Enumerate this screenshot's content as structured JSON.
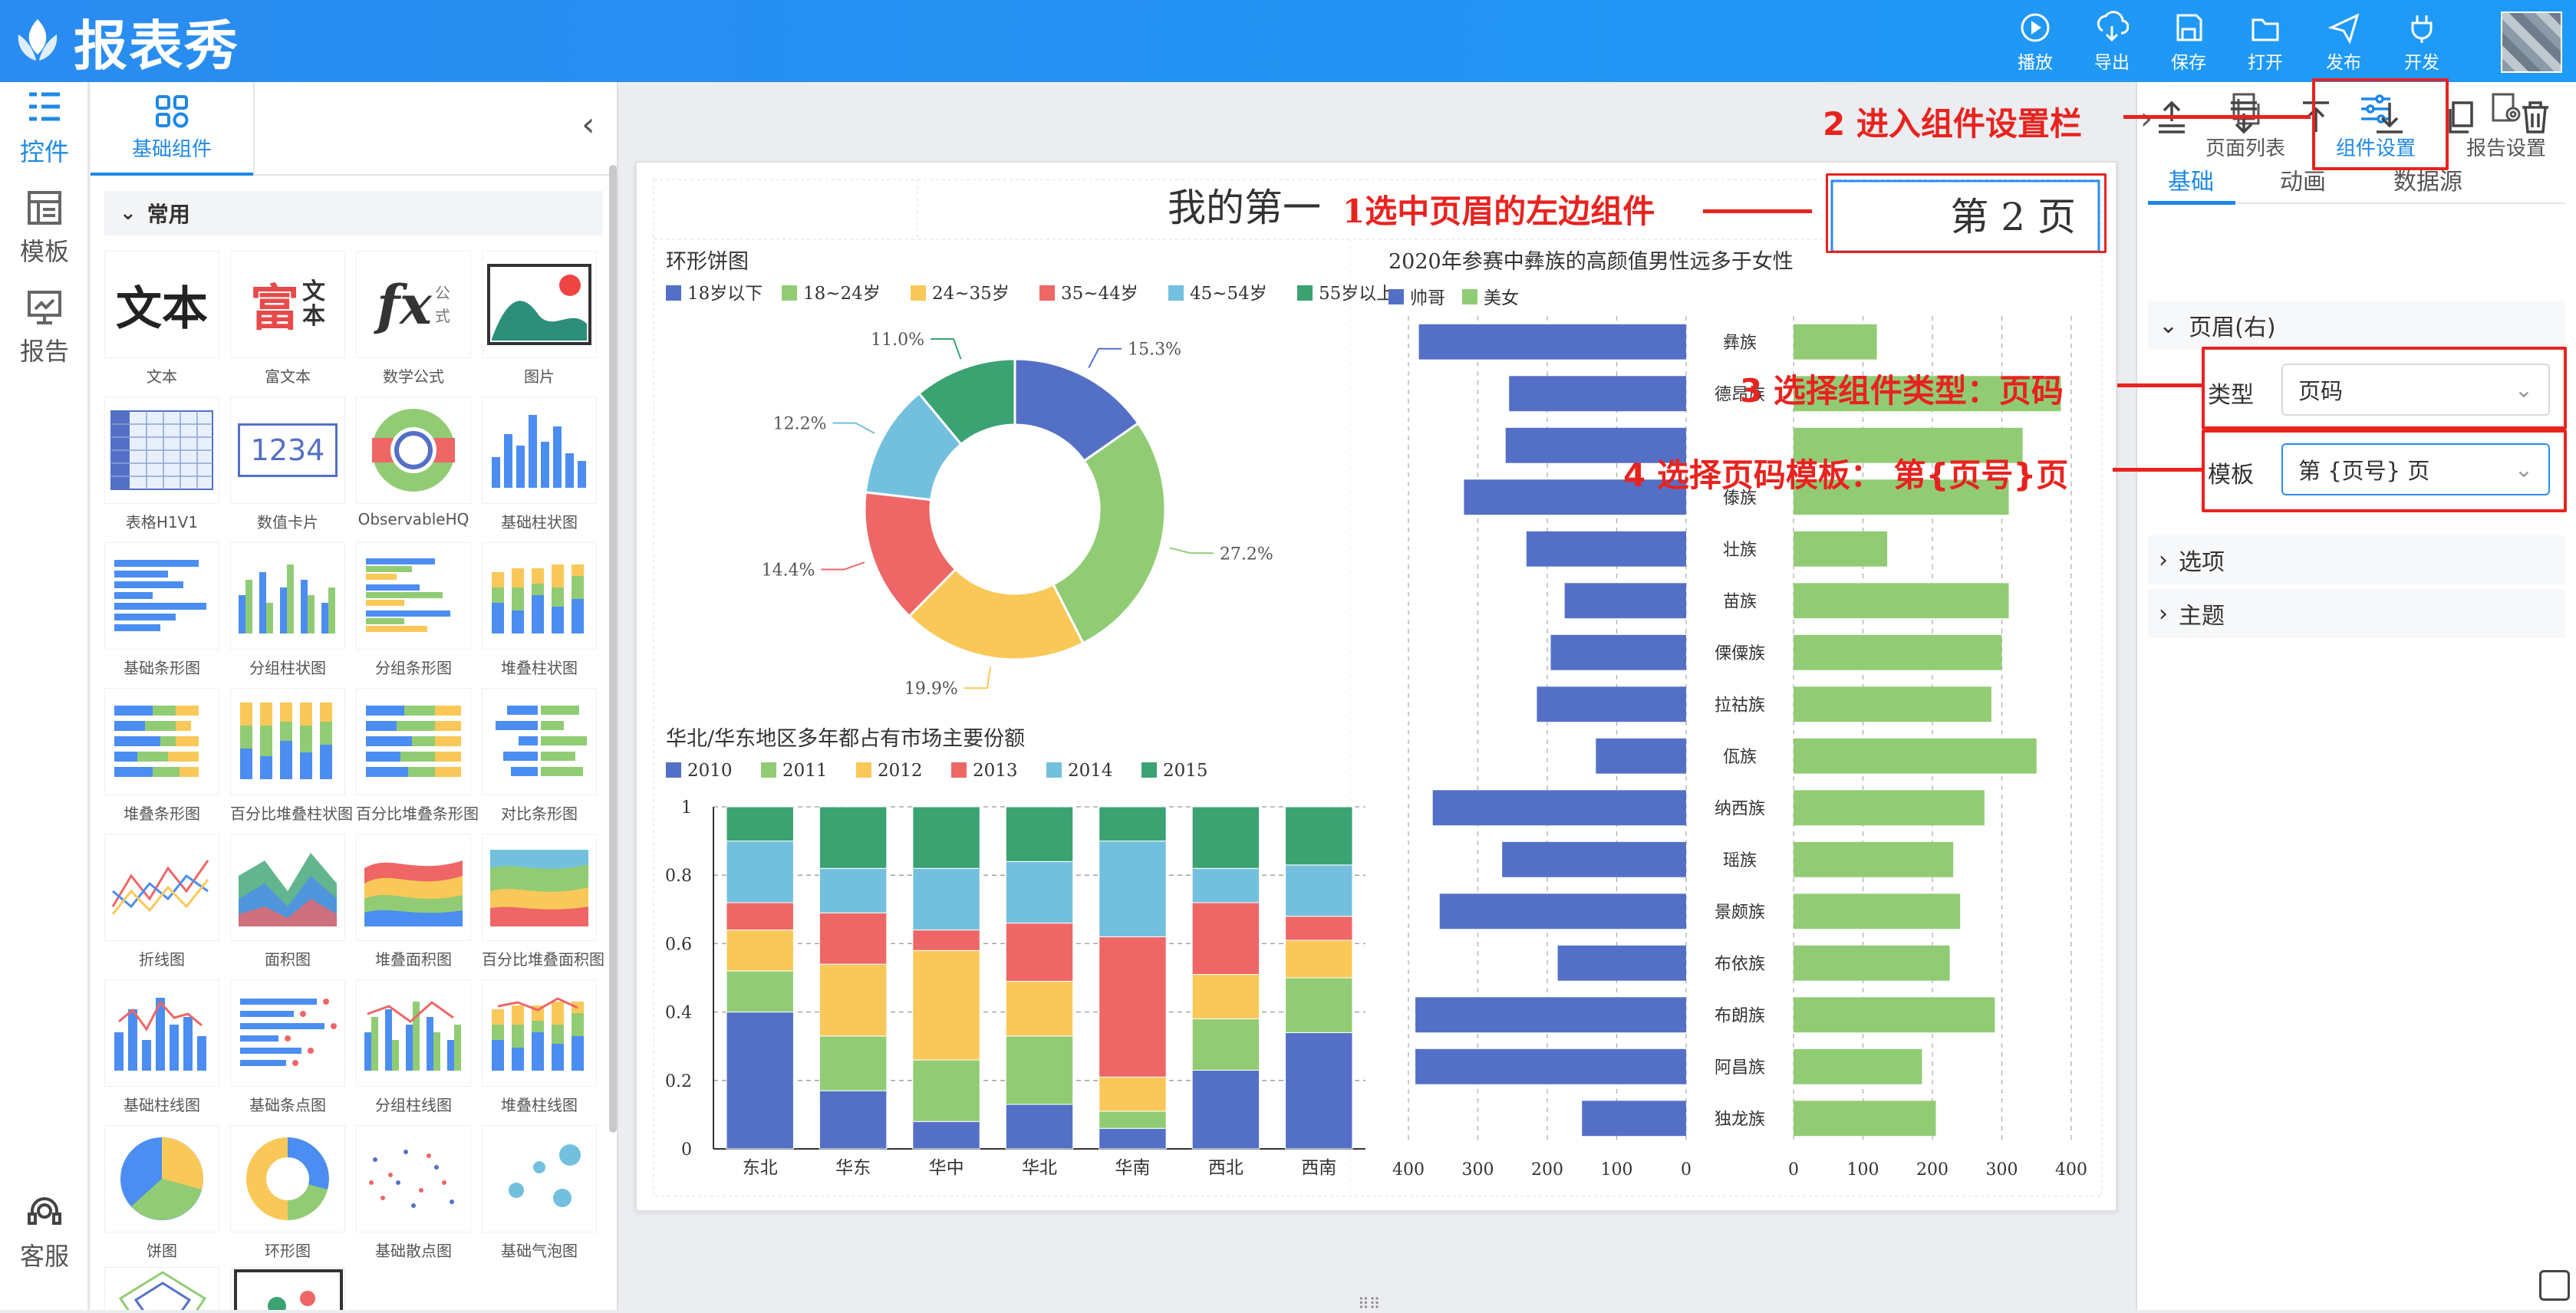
{
  "app": {
    "title": "报表秀"
  },
  "toolbar": {
    "items": [
      {
        "label": "播放",
        "icon": "play-icon"
      },
      {
        "label": "导出",
        "icon": "export-icon"
      },
      {
        "label": "保存",
        "icon": "save-icon"
      },
      {
        "label": "打开",
        "icon": "folder-icon"
      },
      {
        "label": "发布",
        "icon": "send-icon"
      },
      {
        "label": "开发",
        "icon": "plug-icon"
      }
    ]
  },
  "leftnav": {
    "items": [
      {
        "label": "控件",
        "icon": "widgets-icon"
      },
      {
        "label": "模板",
        "icon": "template-icon"
      },
      {
        "label": "报告",
        "icon": "report-icon"
      }
    ],
    "support": "客服"
  },
  "components": {
    "tab": "基础组件",
    "category": "常用",
    "items": [
      {
        "label": "文本",
        "glyph": "文本"
      },
      {
        "label": "富文本"
      },
      {
        "label": "数学公式"
      },
      {
        "label": "图片"
      },
      {
        "label": "表格H1V1"
      },
      {
        "label": "数值卡片",
        "glyph": "1234"
      },
      {
        "label": "ObservableHQ"
      },
      {
        "label": "基础柱状图"
      },
      {
        "label": "基础条形图"
      },
      {
        "label": "分组柱状图"
      },
      {
        "label": "分组条形图"
      },
      {
        "label": "堆叠柱状图"
      },
      {
        "label": "堆叠条形图"
      },
      {
        "label": "百分比堆叠柱状图"
      },
      {
        "label": "百分比堆叠条形图"
      },
      {
        "label": "对比条形图"
      },
      {
        "label": "折线图"
      },
      {
        "label": "面积图"
      },
      {
        "label": "堆叠面积图"
      },
      {
        "label": "百分比堆叠面积图"
      },
      {
        "label": "基础柱线图"
      },
      {
        "label": "基础条点图"
      },
      {
        "label": "分组柱线图"
      },
      {
        "label": "堆叠柱线图"
      },
      {
        "label": "饼图"
      },
      {
        "label": "环形图"
      },
      {
        "label": "基础散点图"
      },
      {
        "label": "基础气泡图"
      }
    ],
    "rich_glyph_1": "富",
    "rich_glyph_2": "文",
    "rich_glyph_3": "本",
    "math_glyph": "fx",
    "math_small_1": "公",
    "math_small_2": "式"
  },
  "report": {
    "header_left": "我的第一",
    "header_right": "第 2 页"
  },
  "chart_data": [
    {
      "type": "pie",
      "title": "环形饼图",
      "legend": [
        "18岁以下",
        "18~24岁",
        "24~35岁",
        "35~44岁",
        "45~54岁",
        "55岁以上"
      ],
      "colors": [
        "#5470c6",
        "#91cc75",
        "#fac858",
        "#ee6666",
        "#73c0de",
        "#3ba272"
      ],
      "values": [
        15.3,
        27.2,
        19.9,
        14.4,
        12.2,
        11.0
      ],
      "labels": [
        "15.3%",
        "27.2%",
        "19.9%",
        "14.4%",
        "12.2%",
        "11.0%"
      ]
    },
    {
      "type": "bar",
      "title": "华北/华东地区多年都占有市场主要份额",
      "categories": [
        "东北",
        "华东",
        "华中",
        "华北",
        "华南",
        "西北",
        "西南"
      ],
      "series": [
        {
          "name": "2010",
          "values": [
            0.4,
            0.17,
            0.08,
            0.13,
            0.06,
            0.23,
            0.34
          ]
        },
        {
          "name": "2011",
          "values": [
            0.12,
            0.16,
            0.18,
            0.2,
            0.05,
            0.15,
            0.16
          ]
        },
        {
          "name": "2012",
          "values": [
            0.12,
            0.21,
            0.32,
            0.16,
            0.1,
            0.13,
            0.11
          ]
        },
        {
          "name": "2013",
          "values": [
            0.08,
            0.15,
            0.06,
            0.17,
            0.41,
            0.21,
            0.07
          ]
        },
        {
          "name": "2014",
          "values": [
            0.18,
            0.13,
            0.18,
            0.18,
            0.28,
            0.1,
            0.15
          ]
        },
        {
          "name": "2015",
          "values": [
            0.1,
            0.18,
            0.18,
            0.16,
            0.1,
            0.18,
            0.17
          ]
        }
      ],
      "yticks": [
        "0",
        "0.2",
        "0.4",
        "0.6",
        "0.8",
        "1"
      ],
      "ylim": [
        0,
        1
      ]
    },
    {
      "type": "bar",
      "orientation": "horizontal-compare",
      "title": "2020年参赛中彝族的高颜值男性远多于女性",
      "categories": [
        "彝族",
        "德昂族",
        "",
        "傣族",
        "壮族",
        "苗族",
        "傈僳族",
        "拉祜族",
        "佤族",
        "纳西族",
        "瑶族",
        "景颇族",
        "布依族",
        "布朗族",
        "阿昌族",
        "独龙族"
      ],
      "series": [
        {
          "name": "帅哥",
          "values": [
            385,
            255,
            260,
            320,
            230,
            175,
            195,
            215,
            130,
            365,
            265,
            355,
            185,
            390,
            390,
            150
          ]
        },
        {
          "name": "美女",
          "values": [
            120,
            385,
            330,
            310,
            135,
            310,
            300,
            285,
            350,
            275,
            230,
            240,
            225,
            290,
            185,
            205
          ]
        }
      ],
      "xticks_left": [
        "400",
        "300",
        "200",
        "100",
        "0"
      ],
      "xticks_right": [
        "0",
        "100",
        "200",
        "300",
        "400"
      ],
      "xlim": [
        0,
        400
      ]
    }
  ],
  "rightpanel": {
    "tabs": [
      "页面列表",
      "组件设置",
      "报告设置"
    ],
    "subtabs": [
      "基础",
      "动画",
      "数据源"
    ],
    "section_header": "页眉(右)",
    "type_label": "类型",
    "type_value": "页码",
    "template_label": "模板",
    "template_value": "第 {页号} 页",
    "sections": [
      "选项",
      "主题"
    ]
  },
  "annotations": {
    "a1": "1选中页眉的左边组件",
    "a2": "2 进入组件设置栏",
    "a3": "3 选择组件类型：页码",
    "a4": "4 选择页码模板： 第{页号}页"
  }
}
